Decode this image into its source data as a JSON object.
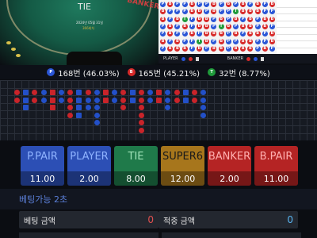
{
  "table": {
    "tie_label": "TIE",
    "banker_label": "BANKER",
    "date": "2024년 05월 31일",
    "round": "366회차"
  },
  "road": {
    "player_label": "PLAYER",
    "banker_label": "BANKER",
    "colors": {
      "player": "#2a56d6",
      "banker": "#d72a2a",
      "tie": "#1f9a3a"
    },
    "cells": [
      "PBPPBPPBPBPBPBPB",
      "BPPPBBPBPPTBBBPP",
      "BPBTPBBPBPBPBPBB",
      "PBPBPBBPTBPBBPBP",
      "PBPPBPBBBPBPBBPB",
      "BPBPPTBPBPPBBPPB",
      "PBBBPBPBBPBBBPBP"
    ]
  },
  "stats": {
    "player": {
      "badge": "P",
      "text": "168번 (46.03%)",
      "color": "#2a56d6"
    },
    "banker": {
      "badge": "B",
      "text": "165번 (45.21%)",
      "color": "#d72a2a"
    },
    "tie": {
      "badge": "T",
      "text": "32번 (8.77%)",
      "color": "#1f9a3a"
    }
  },
  "bead_columns": [
    [
      "r",
      "r"
    ],
    [
      "b",
      "b",
      "b"
    ],
    [
      "r",
      "r"
    ],
    [
      "b",
      "b"
    ],
    [
      "r",
      "r",
      "r"
    ],
    [
      "b",
      "b"
    ],
    [
      "r",
      "r",
      "r",
      "r"
    ],
    [
      "b",
      "b",
      "b",
      "b"
    ],
    [
      "r",
      "b",
      "b"
    ],
    [
      "b",
      "b",
      "b",
      "b",
      "b"
    ],
    [
      "r",
      "r"
    ],
    [
      "b",
      "b"
    ],
    [
      "r",
      "r",
      "r"
    ],
    [
      "b",
      "b"
    ],
    [
      "r",
      "r",
      "r",
      "r",
      "r",
      "r"
    ],
    [
      "b",
      "b"
    ],
    [
      "r",
      "r"
    ],
    [
      "b",
      "b",
      "b"
    ],
    [
      "r",
      "r"
    ],
    [
      "b",
      "b"
    ],
    [
      "r",
      "r"
    ],
    [
      "b",
      "b",
      "b",
      "b"
    ]
  ],
  "bets": [
    {
      "label": "P.PAIR",
      "odds": "11.00",
      "bg": "#2c4fb5",
      "fg": "#8fb3ff"
    },
    {
      "label": "PLAYER",
      "odds": "2.00",
      "bg": "#2c4fb5",
      "fg": "#8fb3ff"
    },
    {
      "label": "TIE",
      "odds": "8.00",
      "bg": "#1f7a4a",
      "fg": "#9fe3b8"
    },
    {
      "label": "SUPER6",
      "odds": "12.00",
      "bg": "#a7761c",
      "fg": "#1a1a1a"
    },
    {
      "label": "BANKER",
      "odds": "2.00",
      "bg": "#b52424",
      "fg": "#ffb0b0"
    },
    {
      "label": "B.PAIR",
      "odds": "11.00",
      "bg": "#b52424",
      "fg": "#ffb0b0"
    }
  ],
  "status": {
    "text": "베팅가능 2초"
  },
  "amounts": {
    "bet_label": "베팅 금액",
    "bet_value": "0",
    "hit_label": "적중 금액",
    "hit_value": "0"
  }
}
